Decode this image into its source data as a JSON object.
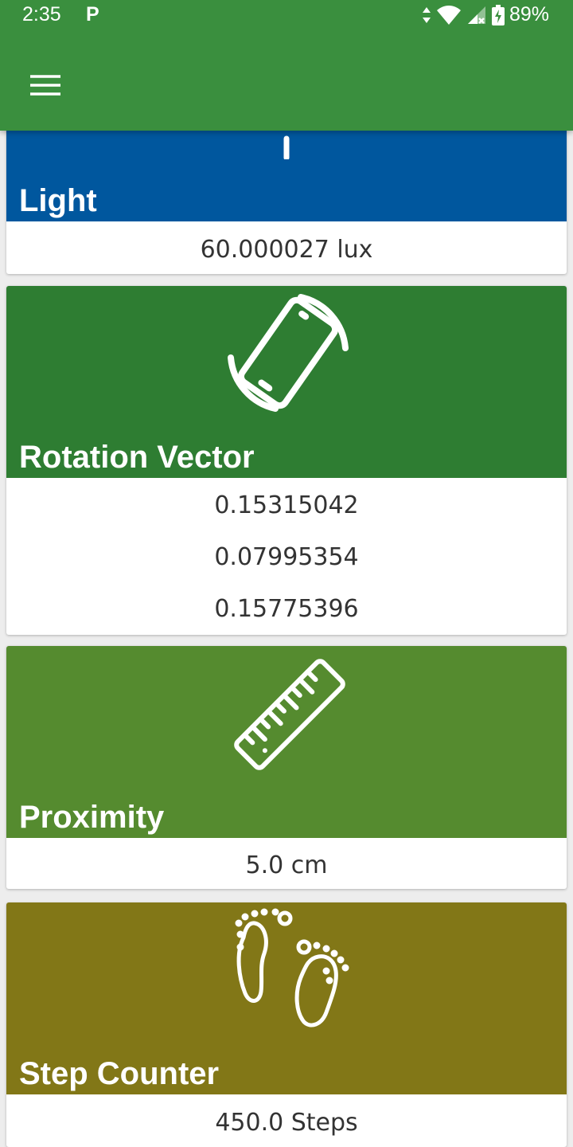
{
  "status_bar": {
    "time": "2:35",
    "notification": "P",
    "battery": "89%"
  },
  "toolbar": {
    "menu_icon": "hamburger-menu-icon"
  },
  "colors": {
    "app_bar": "#3a8f3e",
    "light_card": "#00579e",
    "rotation_card": "#2e7d32",
    "proximity_card": "#558b2f",
    "step_card": "#827717"
  },
  "sensors": [
    {
      "name": "Light",
      "icon": "light-bulb-icon",
      "values": [
        "60.000027 lux"
      ]
    },
    {
      "name": "Rotation Vector",
      "icon": "screen-rotation-icon",
      "values": [
        "0.15315042",
        "0.07995354",
        "0.15775396"
      ]
    },
    {
      "name": "Proximity",
      "icon": "ruler-icon",
      "values": [
        "5.0 cm"
      ]
    },
    {
      "name": "Step Counter",
      "icon": "footprints-icon",
      "values": [
        "450.0 Steps"
      ]
    }
  ]
}
